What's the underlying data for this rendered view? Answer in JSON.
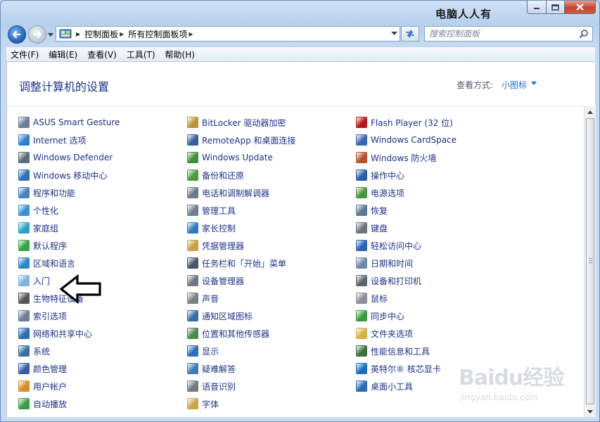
{
  "window": {
    "watermark_title": "电脑人人有",
    "controls": [
      "minimize",
      "maximize",
      "close"
    ]
  },
  "address_bar": {
    "breadcrumbs": [
      "控制面板",
      "所有控制面板项"
    ]
  },
  "search": {
    "placeholder": "搜索控制面板"
  },
  "menu": [
    "文件(F)",
    "编辑(E)",
    "查看(V)",
    "工具(T)",
    "帮助(H)"
  ],
  "header": {
    "title": "调整计算机的设置",
    "view_label": "查看方式:",
    "view_value": "小图标"
  },
  "items": [
    {
      "label": "ASUS Smart Gesture",
      "icon": "asus-gesture-icon",
      "color": "#6d7f96"
    },
    {
      "label": "Internet 选项",
      "icon": "internet-options-icon",
      "color": "#2f7fd0"
    },
    {
      "label": "Windows Defender",
      "icon": "windows-defender-icon",
      "color": "#5a6b7c"
    },
    {
      "label": "Windows 移动中心",
      "icon": "mobility-center-icon",
      "color": "#2d6fb8"
    },
    {
      "label": "程序和功能",
      "icon": "programs-features-icon",
      "color": "#4b7fbf"
    },
    {
      "label": "个性化",
      "icon": "personalization-icon",
      "color": "#3c8ed8"
    },
    {
      "label": "家庭组",
      "icon": "homegroup-icon",
      "color": "#2aa0c9"
    },
    {
      "label": "默认程序",
      "icon": "default-programs-icon",
      "color": "#3aa04a"
    },
    {
      "label": "区域和语言",
      "icon": "region-language-icon",
      "color": "#2d86c8"
    },
    {
      "label": "入门",
      "icon": "getting-started-icon",
      "color": "#7fb2e0"
    },
    {
      "label": "生物特征设备",
      "icon": "biometric-icon",
      "color": "#555555"
    },
    {
      "label": "索引选项",
      "icon": "indexing-icon",
      "color": "#6b7f95"
    },
    {
      "label": "网络和共享中心",
      "icon": "network-sharing-icon",
      "color": "#2c6cb6"
    },
    {
      "label": "系统",
      "icon": "system-icon",
      "color": "#3d6fa5"
    },
    {
      "label": "颜色管理",
      "icon": "color-management-icon",
      "color": "#3a5fa6"
    },
    {
      "label": "用户帐户",
      "icon": "user-accounts-icon",
      "color": "#d98b2b"
    },
    {
      "label": "自动播放",
      "icon": "autoplay-icon",
      "color": "#3f9a45"
    },
    {
      "label": "BitLocker 驱动器加密",
      "icon": "bitlocker-icon",
      "color": "#b9963a"
    },
    {
      "label": "RemoteApp 和桌面连接",
      "icon": "remoteapp-icon",
      "color": "#355fa1"
    },
    {
      "label": "Windows Update",
      "icon": "windows-update-icon",
      "color": "#3e8f3a"
    },
    {
      "label": "备份和还原",
      "icon": "backup-restore-icon",
      "color": "#4d9a3f"
    },
    {
      "label": "电话和调制解调器",
      "icon": "phone-modem-icon",
      "color": "#687a8d"
    },
    {
      "label": "管理工具",
      "icon": "admin-tools-icon",
      "color": "#6e7f90"
    },
    {
      "label": "家长控制",
      "icon": "parental-controls-icon",
      "color": "#2f7bc4"
    },
    {
      "label": "凭据管理器",
      "icon": "credential-manager-icon",
      "color": "#c7a247"
    },
    {
      "label": "任务栏和「开始」菜单",
      "icon": "taskbar-start-icon",
      "color": "#4a5666"
    },
    {
      "label": "设备管理器",
      "icon": "device-manager-icon",
      "color": "#6b7682"
    },
    {
      "label": "声音",
      "icon": "sound-icon",
      "color": "#7a7f86"
    },
    {
      "label": "通知区域图标",
      "icon": "notification-area-icon",
      "color": "#3c6ba8"
    },
    {
      "label": "位置和其他传感器",
      "icon": "location-sensors-icon",
      "color": "#4c8a4a"
    },
    {
      "label": "显示",
      "icon": "display-icon",
      "color": "#2f6fb9"
    },
    {
      "label": "疑难解答",
      "icon": "troubleshooting-icon",
      "color": "#3e7ab8"
    },
    {
      "label": "语音识别",
      "icon": "speech-recognition-icon",
      "color": "#707880"
    },
    {
      "label": "字体",
      "icon": "fonts-icon",
      "color": "#c9a44a"
    },
    {
      "label": "Flash Player (32 位)",
      "icon": "flash-player-icon",
      "color": "#b31b1b"
    },
    {
      "label": "Windows CardSpace",
      "icon": "cardspace-icon",
      "color": "#3a66b0"
    },
    {
      "label": "Windows 防火墙",
      "icon": "firewall-icon",
      "color": "#b5532c"
    },
    {
      "label": "操作中心",
      "icon": "action-center-icon",
      "color": "#2b5ca8"
    },
    {
      "label": "电源选项",
      "icon": "power-options-icon",
      "color": "#4c9440"
    },
    {
      "label": "恢复",
      "icon": "recovery-icon",
      "color": "#5a7892"
    },
    {
      "label": "键盘",
      "icon": "keyboard-icon",
      "color": "#6d7379"
    },
    {
      "label": "轻松访问中心",
      "icon": "ease-of-access-icon",
      "color": "#2e63b0"
    },
    {
      "label": "日期和时间",
      "icon": "date-time-icon",
      "color": "#6f88a8"
    },
    {
      "label": "设备和打印机",
      "icon": "devices-printers-icon",
      "color": "#5d6670"
    },
    {
      "label": "鼠标",
      "icon": "mouse-icon",
      "color": "#8a8f95"
    },
    {
      "label": "同步中心",
      "icon": "sync-center-icon",
      "color": "#3c9a3c"
    },
    {
      "label": "文件夹选项",
      "icon": "folder-options-icon",
      "color": "#d6b04a"
    },
    {
      "label": "性能信息和工具",
      "icon": "performance-icon",
      "color": "#3f6f3f"
    },
    {
      "label": "英特尔® 核芯显卡",
      "icon": "intel-graphics-icon",
      "color": "#1d6fb8"
    },
    {
      "label": "桌面小工具",
      "icon": "desktop-gadgets-icon",
      "color": "#2e6cae"
    }
  ],
  "watermark": {
    "text": "Baidu经验",
    "sub": "jingyan.baidu.com"
  }
}
